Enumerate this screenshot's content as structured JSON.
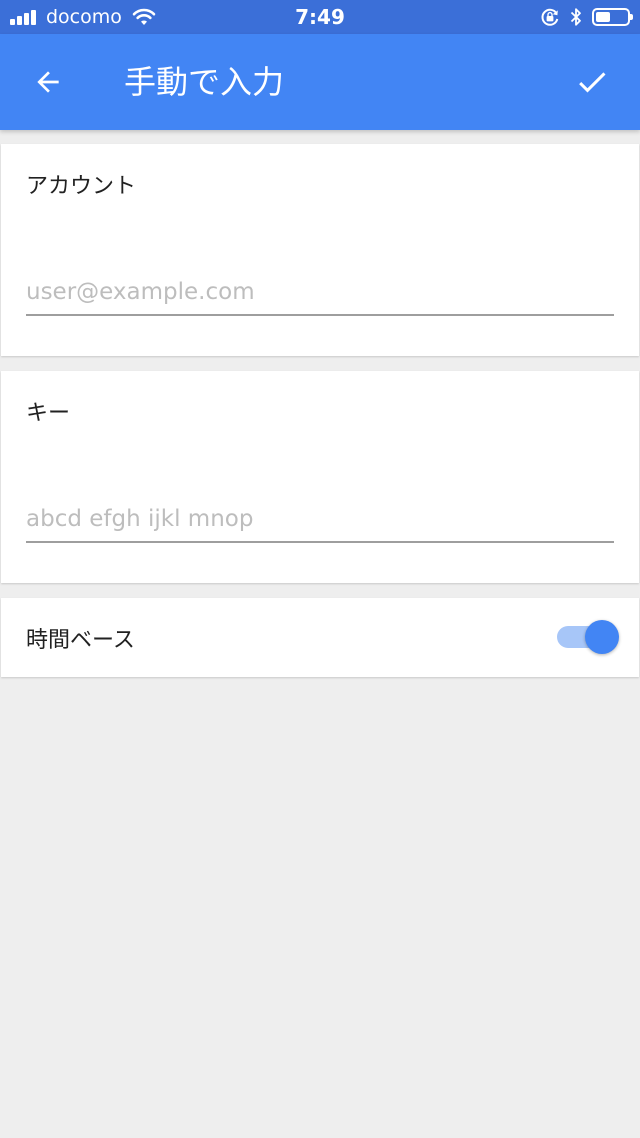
{
  "status_bar": {
    "carrier": "docomo",
    "time": "7:49",
    "battery_level": 0.45
  },
  "app_bar": {
    "title": "手動で入力",
    "back_icon": "arrow-back-icon",
    "confirm_icon": "check-icon"
  },
  "account": {
    "label": "アカウント",
    "value": "",
    "placeholder": "user@example.com"
  },
  "key": {
    "label": "キー",
    "value": "",
    "placeholder": "abcd efgh ijkl mnop"
  },
  "time_based": {
    "label": "時間ベース",
    "enabled": true
  },
  "colors": {
    "status_bar": "#3b6fd8",
    "app_bar": "#4285f4",
    "background": "#eeeeee",
    "toggle_thumb": "#4285f4",
    "toggle_track": "#a7c6f8"
  }
}
